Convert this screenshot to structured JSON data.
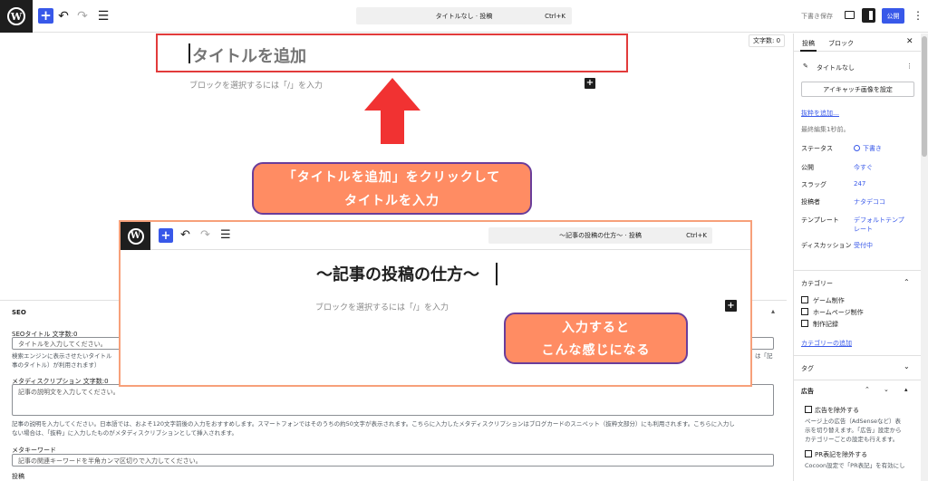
{
  "topbar": {
    "logo": "W",
    "add_label": "+",
    "undo_icon": "↶",
    "redo_icon": "↷",
    "list_icon": "☰",
    "command_text": "タイトルなし · 投稿",
    "command_shortcut": "Ctrl+K",
    "save_draft": "下書き保存",
    "publish": "公開",
    "more": "⋮"
  },
  "editor": {
    "word_count": "文字数: 0",
    "title_placeholder": "タイトルを追加",
    "block_hint": "ブロックを選択するには「/」を入力",
    "block_add": "+"
  },
  "annotations": {
    "callout1_line1": "「タイトルを追加」をクリックして",
    "callout1_line2": "タイトルを入力",
    "callout2_line1": "入力すると",
    "callout2_line2": "こんな感じになる",
    "arrow_color": "#f13232",
    "callout_bg": "#ff8c63",
    "callout_border": "#6a3d9a"
  },
  "example_shot": {
    "logo": "W",
    "add_label": "+",
    "undo_icon": "↶",
    "redo_icon": "↷",
    "list_icon": "☰",
    "command_text": "〜記事の投稿の仕方〜 · 投稿",
    "command_shortcut": "Ctrl+K",
    "title": "〜記事の投稿の仕方〜",
    "block_hint": "ブロックを選択するには「/」を入力",
    "block_add": "+"
  },
  "seo": {
    "heading": "SEO",
    "title_label": "SEOタイトル 文字数:0",
    "title_placeholder": "タイトルを入力してください。",
    "title_help_left": "検索エンジンに表示させたいタイトル",
    "title_help_left2": "事のタイトル）が利用されます）",
    "title_help_right": "は「記",
    "desc_label": "メタディスクリプション 文字数:0",
    "desc_placeholder": "記事の説明文を入力してください。",
    "desc_help": "記事の説明を入力してください。日本語では、およそ120文字前後の入力をおすすめします。スマートフォンではそのうちの約50文字が表示されます。こちらに入力したメタディスクリプションはブログカードのスニペット（抜粋文部分）にも利用されます。こちらに入力しない場合は、「抜粋」に入力したものがメタディスクリプションとして挿入されます。",
    "desc_help_line1": "記事の説明を入力してください。日本語では、およそ120文字前後の入力をおすすめします。スマートフォンではそのうちの約50文字が表示されます。こちらに入力したメタディスクリプションはブログカードのスニペット（抜粋文部分）にも利用されます。こちらに入力し",
    "desc_help_line2": "ない場合は、「抜粋」に入力したものがメタディスクリプションとして挿入されます。",
    "keyword_label": "メタキーワード",
    "keyword_placeholder": "記事の関連キーワードを半角カンマ区切りで入力してください。",
    "footer_label": "投稿",
    "ctrl_up": "▴"
  },
  "sidebar": {
    "tab_post": "投稿",
    "tab_block": "ブロック",
    "close": "✕",
    "post_title": "タイトルなし",
    "post_more": "⋮",
    "featured_image": "アイキャッチ画像を設定",
    "add_excerpt": "抜粋を追加…",
    "last_edited": "最終編集1秒前。",
    "rows": [
      {
        "label": "ステータス",
        "value": "下書き"
      },
      {
        "label": "公開",
        "value": "今すぐ"
      },
      {
        "label": "スラッグ",
        "value": "247"
      },
      {
        "label": "投稿者",
        "value": "ナタデココ"
      },
      {
        "label": "テンプレート",
        "value": "デフォルトテンプレート"
      },
      {
        "label": "ディスカッション",
        "value": "受付中"
      }
    ],
    "template_value_line1": "デフォルトテンプ",
    "template_value_line2": "レート",
    "categories_heading": "カテゴリー",
    "categories": [
      "ゲーム制作",
      "ホームページ制作",
      "制作記録"
    ],
    "add_category": "カテゴリーの追加",
    "tags_heading": "タグ",
    "ads_heading": "広告",
    "ads_exclude": "広告を除外する",
    "ads_help": "ページ上の広告（AdSenseなど）表示を切り替えます。「広告」設定からカテゴリーごとの設定も行えます。",
    "ads_help_line1": "ページ上の広告（AdSenseなど）表",
    "ads_help_line2": "示を切り替えます。「広告」設定から",
    "ads_help_line3": "カテゴリーごとの設定も行えます。",
    "pr_exclude": "PR表記を除外する",
    "pr_help": "Cocoon設定で「PR表記」を有効にし",
    "chev_up": "⌃",
    "chev_down": "⌄",
    "tri_up": "▴"
  }
}
